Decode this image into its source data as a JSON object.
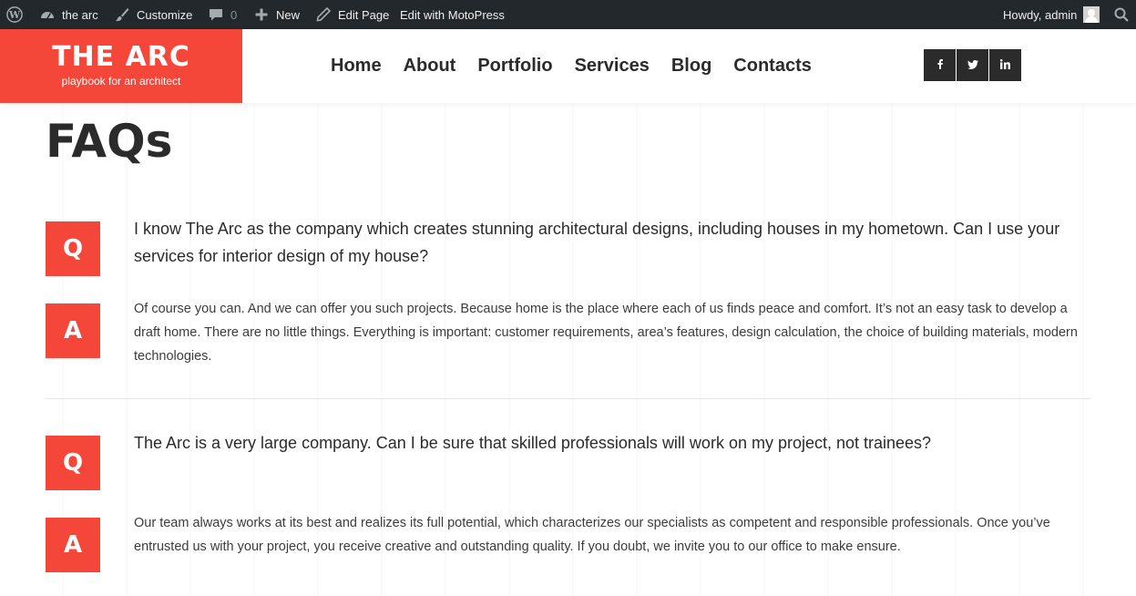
{
  "admin_bar": {
    "site_name": "the arc",
    "customize": "Customize",
    "comments_count": "0",
    "new": "New",
    "edit_page": "Edit Page",
    "edit_motopress": "Edit with MotoPress",
    "greeting": "Howdy, admin"
  },
  "header": {
    "logo_title": "THE ARC",
    "logo_tagline": "playbook for an architect",
    "nav": [
      "Home",
      "About",
      "Portfolio",
      "Services",
      "Blog",
      "Contacts"
    ],
    "social_icons": [
      "facebook-icon",
      "twitter-icon",
      "linkedin-icon"
    ]
  },
  "colors": {
    "accent": "#f4473a",
    "admin_bar": "#23282d",
    "dark": "#2b2b2b"
  },
  "page": {
    "title": "FAQs",
    "q_label": "Q",
    "a_label": "A",
    "faqs": [
      {
        "question": "I know The Arc as the company which creates stunning architectural designs, including houses in my hometown. Can I use your services for interior design of my house?",
        "answer": "Of course you can. And we can offer you such projects. Because home is the place where each of us finds peace and comfort. It’s not an easy task to develop a draft home. There are no little things. Everything is important: customer requirements, area’s features, design calculation, the choice of building materials, modern technologies."
      },
      {
        "question": "The Arc is a very large company. Can I be sure that skilled professionals will work on my project, not trainees?",
        "answer": "Our team always works at its best and realizes its full potential, which characterizes our specialists as competent and responsible professionals. Once you’ve entrusted us with your project, you receive creative and outstanding quality. If you doubt, we invite you to our office to make ensure."
      }
    ]
  }
}
